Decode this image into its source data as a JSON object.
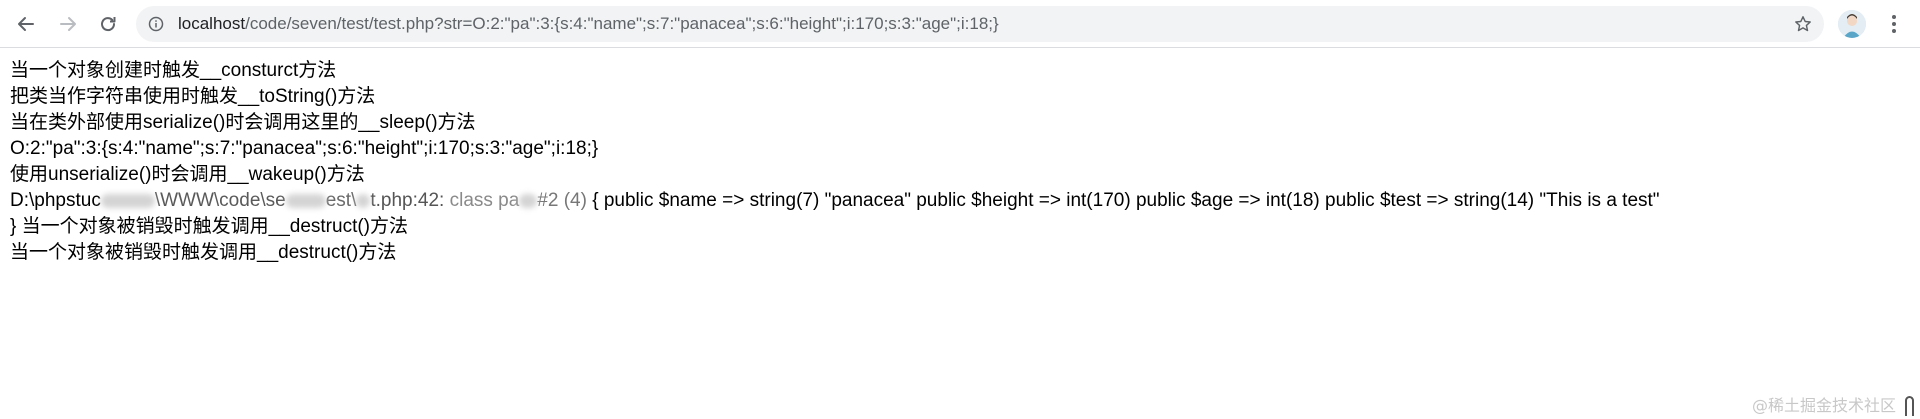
{
  "browser": {
    "url_host": "localhost",
    "url_path": "/code/seven/test/test.php?str=O:2:\"pa\":3:{s:4:\"name\";s:7:\"panacea\";s:6:\"height\";i:170;s:3:\"age\";i:18;}",
    "icons": {
      "back": "arrow-left-icon",
      "forward": "arrow-right-icon",
      "reload": "reload-icon",
      "info": "info-circle-icon",
      "bookmark": "star-icon",
      "profile": "avatar",
      "menu": "kebab-menu-icon"
    }
  },
  "output": {
    "line1": "当一个对象创建时触发__consturct方法",
    "line2": "把类当作字符串使用时触发__toString()方法",
    "line3": "当在类外部使用serialize()时会调用这里的__sleep()方法",
    "line4": "O:2:\"pa\":3:{s:4:\"name\";s:7:\"panacea\";s:6:\"height\";i:170;s:3:\"age\";i:18;}",
    "line5": "使用unserialize()时会调用__wakeup()方法",
    "line6_prefix": "D:\\phpstuc",
    "line6_mid1": "\\WWW\\code\\se",
    "line6_mid2": "est\\",
    "line6_mid3": "t.php:42:",
    "line6_mid4": "class pa",
    "line6_mid5": "#2 (4)",
    "line6_suffix": "{ public $name => string(7) \"panacea\" public $height => int(170) public $age => int(18) public $test => string(14) \"This is a test\"",
    "line7": "} 当一个对象被销毁时触发调用__destruct()方法",
    "line8": "当一个对象被销毁时触发调用__destruct()方法"
  },
  "watermark": "@稀土掘金技术社区"
}
